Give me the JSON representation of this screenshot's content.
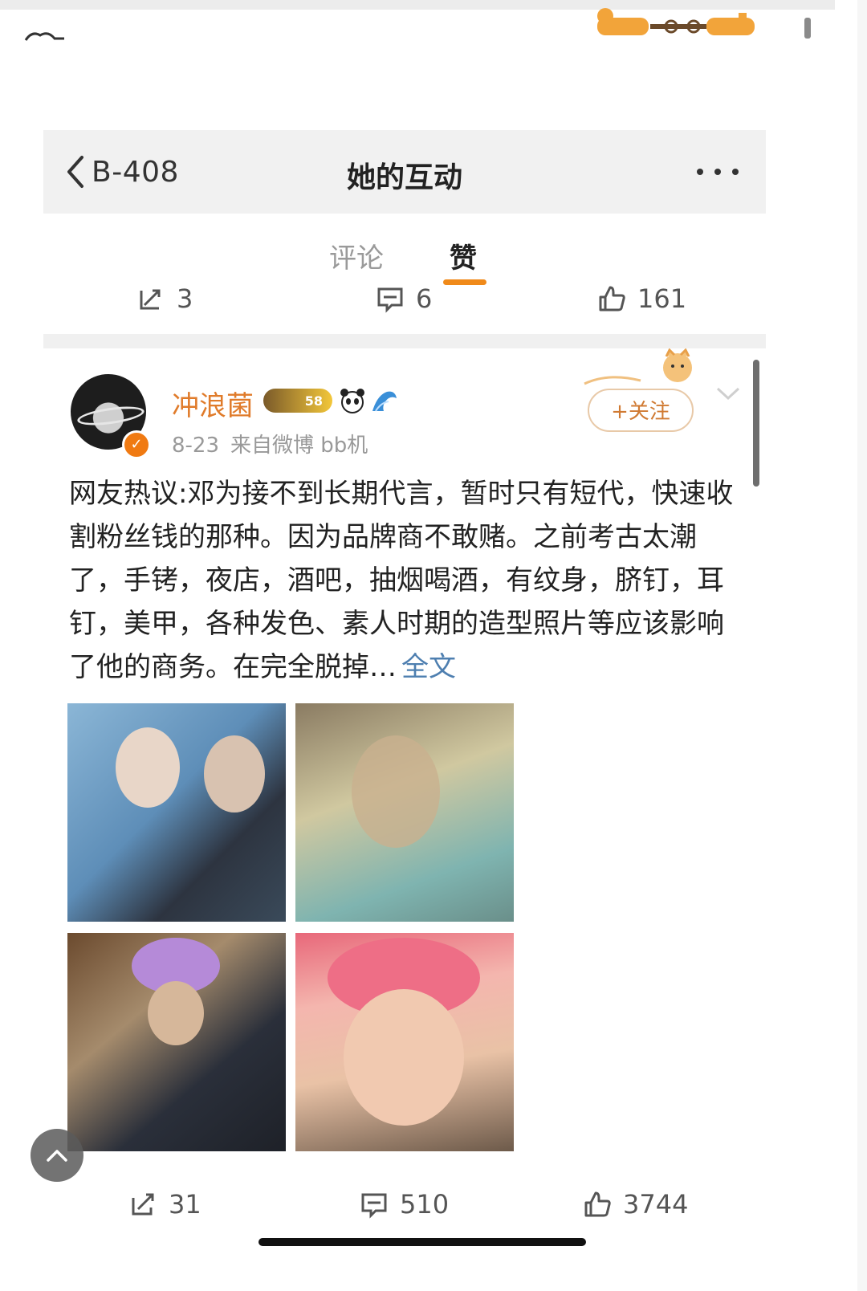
{
  "header": {
    "back_label": "B-408",
    "title": "她的互动"
  },
  "tabs": [
    {
      "label": "评论",
      "active": false
    },
    {
      "label": "赞",
      "active": true
    }
  ],
  "top_stats": {
    "reposts": "3",
    "comments": "6",
    "likes": "161"
  },
  "post": {
    "user_name": "冲浪菌",
    "level": "58",
    "date": "8-23",
    "source": "来自微博 bb机",
    "follow_label": "+关注",
    "text": "网友热议:邓为接不到长期代言，暂时只有短代，快速收割粉丝钱的那种。因为品牌商不敢赌。之前考古太潮了，手铐，夜店，酒吧，抽烟喝酒，有纹身，脐钉，耳钉，美甲，各种发色、素人时期的造型照片等应该影响了他的商务。在完全脱掉…",
    "full_text_link": "全文",
    "stats": {
      "reposts": "31",
      "comments": "510",
      "likes": "3744"
    }
  },
  "colors": {
    "accent_orange": "#f08a1a",
    "username": "#e07b2a",
    "link_blue": "#4e7fb0"
  },
  "icons": [
    "chevron-left-icon",
    "more-icon",
    "repost-icon",
    "comment-icon",
    "like-icon",
    "verified-icon",
    "panda-icon",
    "wave-icon",
    "chevron-down-icon",
    "arrow-up-icon"
  ]
}
